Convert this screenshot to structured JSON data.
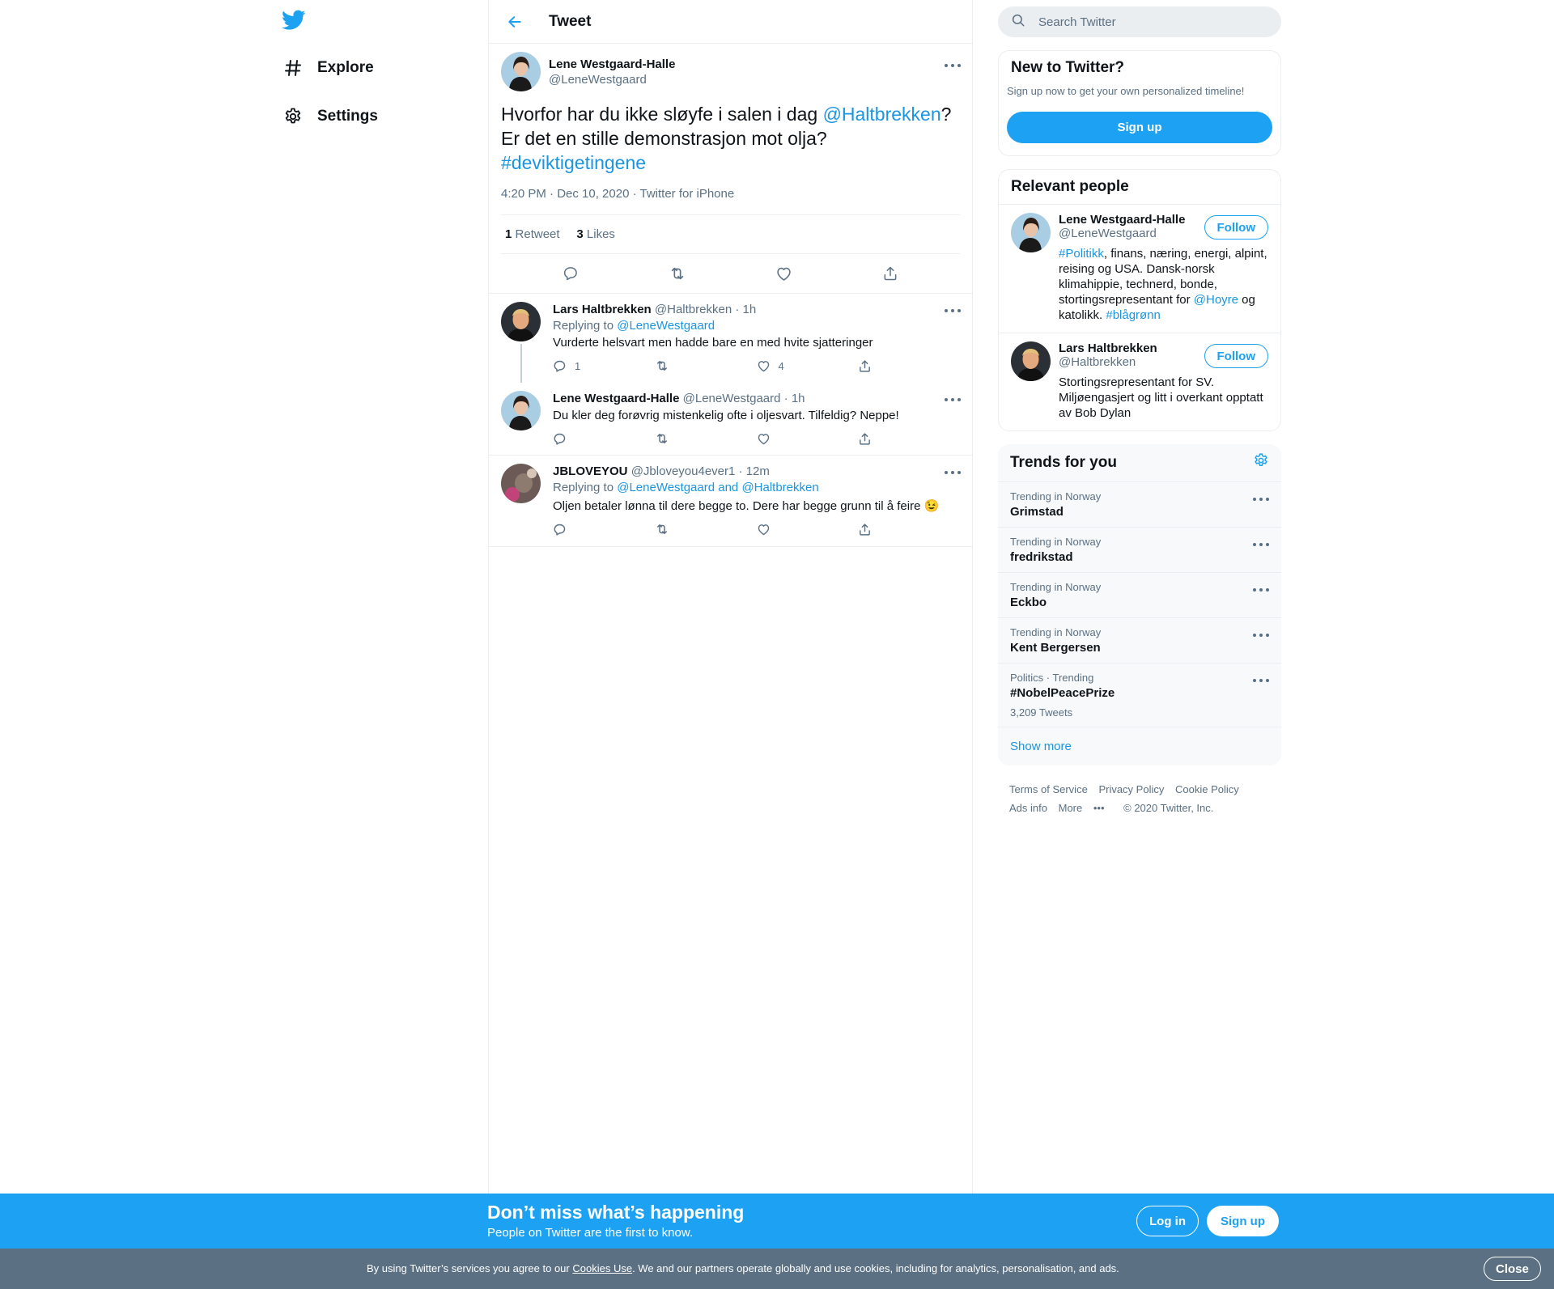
{
  "nav": {
    "explore": "Explore",
    "settings": "Settings"
  },
  "header": {
    "title": "Tweet"
  },
  "main_tweet": {
    "name": "Lene Westgaard-Halle",
    "handle": "@LeneWestgaard",
    "text_part1": "Hvorfor har du ikke sløyfe i salen i dag ",
    "mention": "@Haltbrekken",
    "text_part2": "? Er det en stille demonstrasjon mot olja?",
    "hashtag": "#deviktigetingene",
    "meta": "4:20 PM · Dec 10, 2020 · Twitter for iPhone",
    "retweets_count": "1",
    "retweets_label": "Retweet",
    "likes_count": "3",
    "likes_label": "Likes"
  },
  "replies": [
    {
      "name": "Lars Haltbrekken",
      "handle": "@Haltbrekken",
      "time": "· 1h",
      "replying_prefix": "Replying to ",
      "replying_to": "@LeneWestgaard",
      "text": "Vurderte helsvart men hadde bare en med hvite sjatteringer",
      "reply_count": "1",
      "like_count": "4"
    },
    {
      "name": "Lene Westgaard-Halle",
      "handle": "@LeneWestgaard",
      "time": "· 1h",
      "text": "Du kler deg forøvrig mistenkelig ofte i oljesvart. Tilfeldig? Neppe!"
    },
    {
      "name": "JBLOVEYOU",
      "handle": "@Jbloveyou4ever1",
      "time": "· 12m",
      "replying_prefix": "Replying to ",
      "replying_to": "@LeneWestgaard and @Haltbrekken",
      "text": "Oljen betaler lønna til dere begge to. Dere har begge grunn til å feire 😉"
    }
  ],
  "search": {
    "placeholder": "Search Twitter"
  },
  "new_to_twitter": {
    "title": "New to Twitter?",
    "subtitle": "Sign up now to get your own personalized timeline!",
    "button": "Sign up"
  },
  "relevant_people": {
    "title": "Relevant people",
    "people": [
      {
        "name": "Lene Westgaard-Halle",
        "handle": "@LeneWestgaard",
        "follow": "Follow",
        "bio_tag1": "#Politikk",
        "bio_text1": ", finans, næring, energi, alpint, reising og USA. Dansk-norsk klimahippie, technerd, bonde, stortingsrepresentant for ",
        "bio_mention": "@Hoyre",
        "bio_text2": " og katolikk. ",
        "bio_tag2": "#blågrønn"
      },
      {
        "name": "Lars Haltbrekken",
        "handle": "@Haltbrekken",
        "follow": "Follow",
        "bio": "Stortingsrepresentant for SV. Miljøengasjert og litt i overkant opptatt av Bob Dylan"
      }
    ]
  },
  "trends": {
    "title": "Trends for you",
    "items": [
      {
        "context": "Trending in Norway",
        "name": "Grimstad"
      },
      {
        "context": "Trending in Norway",
        "name": "fredrikstad"
      },
      {
        "context": "Trending in Norway",
        "name": "Eckbo"
      },
      {
        "context": "Trending in Norway",
        "name": "Kent Bergersen"
      },
      {
        "context": "Politics · Trending",
        "name": "#NobelPeacePrize",
        "count": "3,209 Tweets"
      }
    ],
    "show_more": "Show more"
  },
  "footer": {
    "terms": "Terms of Service",
    "privacy": "Privacy Policy",
    "cookie": "Cookie Policy",
    "ads": "Ads info",
    "more": "More",
    "copyright": "© 2020 Twitter, Inc."
  },
  "banner": {
    "title": "Don’t miss what’s happening",
    "subtitle": "People on Twitter are the first to know.",
    "login": "Log in",
    "signup": "Sign up"
  },
  "cookie_bar": {
    "text_before": "By using Twitter’s services you agree to our ",
    "link": "Cookies Use",
    "text_after": ". We and our partners operate globally and use cookies, including for analytics, personalisation, and ads.",
    "close": "Close"
  },
  "colors": {
    "accent": "#1da1f2",
    "link": "#1b95e0",
    "secondary_text": "#5b7083",
    "cookie_bar": "#5b7083"
  }
}
